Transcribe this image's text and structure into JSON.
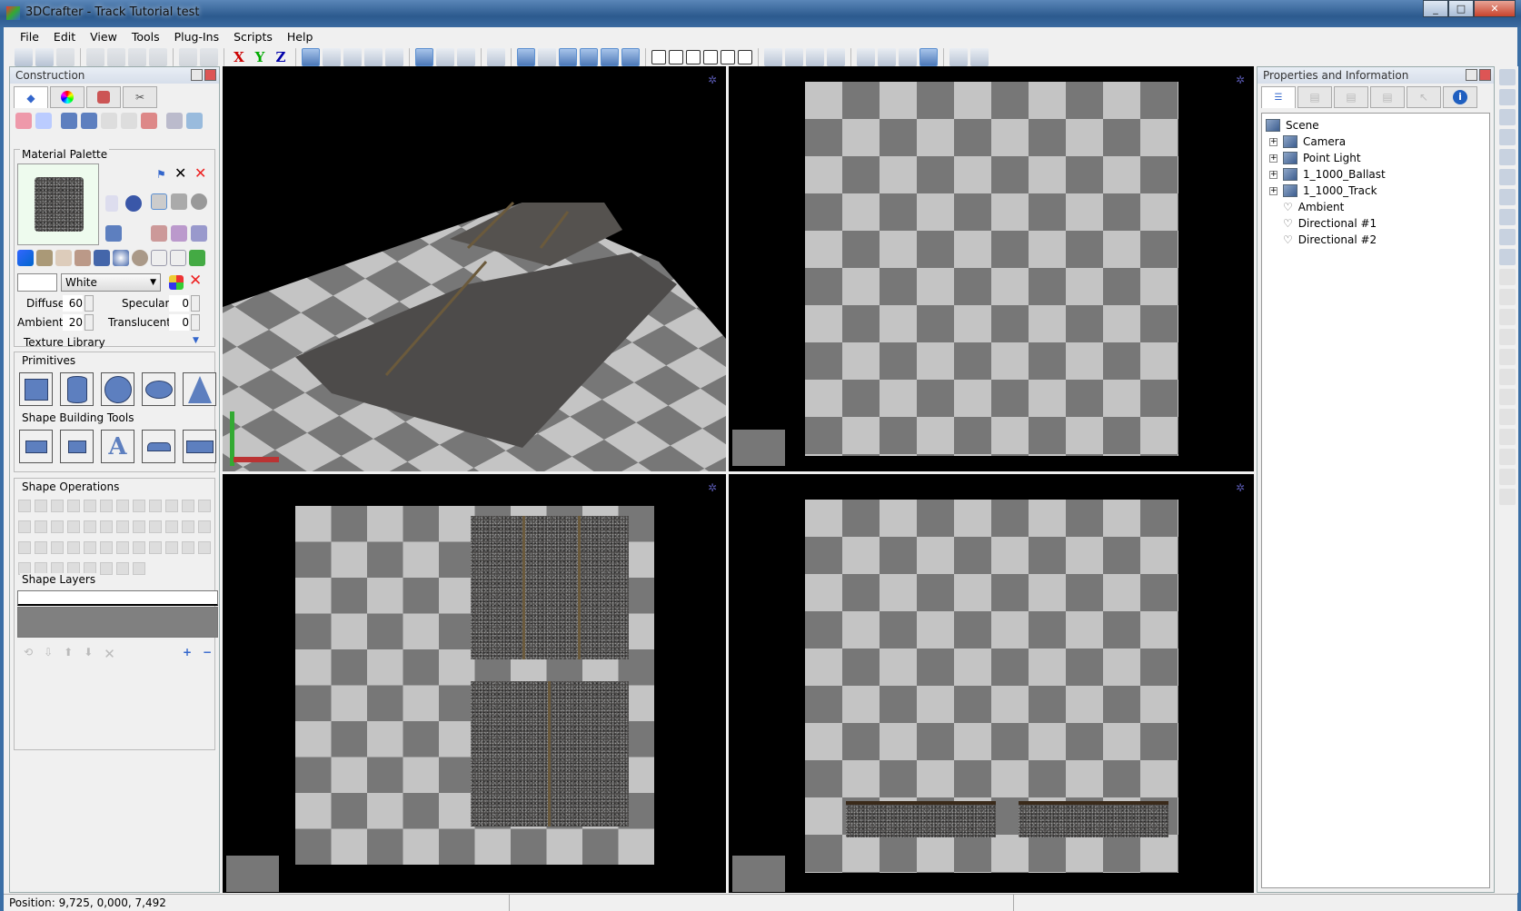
{
  "window": {
    "title": "3DCrafter - Track Tutorial test",
    "minimize": "_",
    "maximize": "□",
    "close": "✕"
  },
  "menu": [
    "File",
    "Edit",
    "View",
    "Tools",
    "Plug-Ins",
    "Scripts",
    "Help"
  ],
  "toolbar": {
    "x": "X",
    "y": "Y",
    "z": "Z",
    "icons": [
      "new-icon",
      "open-icon",
      "save-icon",
      "sep",
      "cut-icon",
      "copy-icon",
      "paste-icon",
      "delete-icon",
      "sep",
      "undo-icon",
      "redo-icon",
      "sep",
      "AXIS",
      "sep",
      "zoom-extents-icon",
      "zoom-selected-icon",
      "zoom-sphere-icon",
      "zoom-object-icon",
      "zoom-window-icon",
      "sep",
      "select-region-icon",
      "texture-icon",
      "material-icon",
      "sep",
      "snap-icon",
      "sep",
      "solid-view-icon",
      "axes-icon",
      "animate-icon",
      "camera-icon",
      "light-icon",
      "path-icon",
      "sep",
      "single-view-icon",
      "split-vertical-icon",
      "split-horizontal-icon",
      "quad-view-icon",
      "three-view-icon",
      "three-view-alt-icon",
      "sep",
      "render-icon",
      "camera-fly-icon",
      "pencil-icon",
      "figure-icon",
      "sep",
      "background-icon",
      "image-icon",
      "layers-icon",
      "window-icon",
      "sep",
      "capture-icon",
      "help-icon"
    ]
  },
  "construction": {
    "title": "Construction",
    "material_palette": {
      "title": "Material Palette",
      "color_name": "White",
      "diffuse_label": "Diffuse",
      "diffuse": "60",
      "specular_label": "Specular",
      "specular": "0",
      "ambient_label": "Ambient",
      "ambient": "20",
      "translucent_label": "Translucent",
      "translucent": "0",
      "texture_library": "Texture Library"
    },
    "primitives": {
      "title": "Primitives",
      "items": [
        "cube",
        "cylinder",
        "sphere",
        "torus",
        "cone"
      ]
    },
    "shape_building": {
      "title": "Shape Building Tools",
      "items": [
        "lathe",
        "extrude",
        "text",
        "terrain",
        "plane"
      ]
    },
    "shape_operations": {
      "title": "Shape Operations"
    },
    "shape_layers": {
      "title": "Shape Layers",
      "add": "+",
      "remove": "−"
    }
  },
  "properties": {
    "title": "Properties and Information",
    "tree": [
      {
        "label": "Scene",
        "type": "root"
      },
      {
        "label": "Camera",
        "type": "node"
      },
      {
        "label": "Point Light",
        "type": "node"
      },
      {
        "label": "1_1000_Ballast",
        "type": "node"
      },
      {
        "label": "1_1000_Track",
        "type": "node"
      },
      {
        "label": "Ambient",
        "type": "light"
      },
      {
        "label": "Directional #1",
        "type": "light"
      },
      {
        "label": "Directional #2",
        "type": "light"
      }
    ]
  },
  "viewports": [
    "perspective",
    "top",
    "front",
    "side"
  ],
  "status": {
    "position": "Position: 9,725, 0,000, 7,492"
  }
}
